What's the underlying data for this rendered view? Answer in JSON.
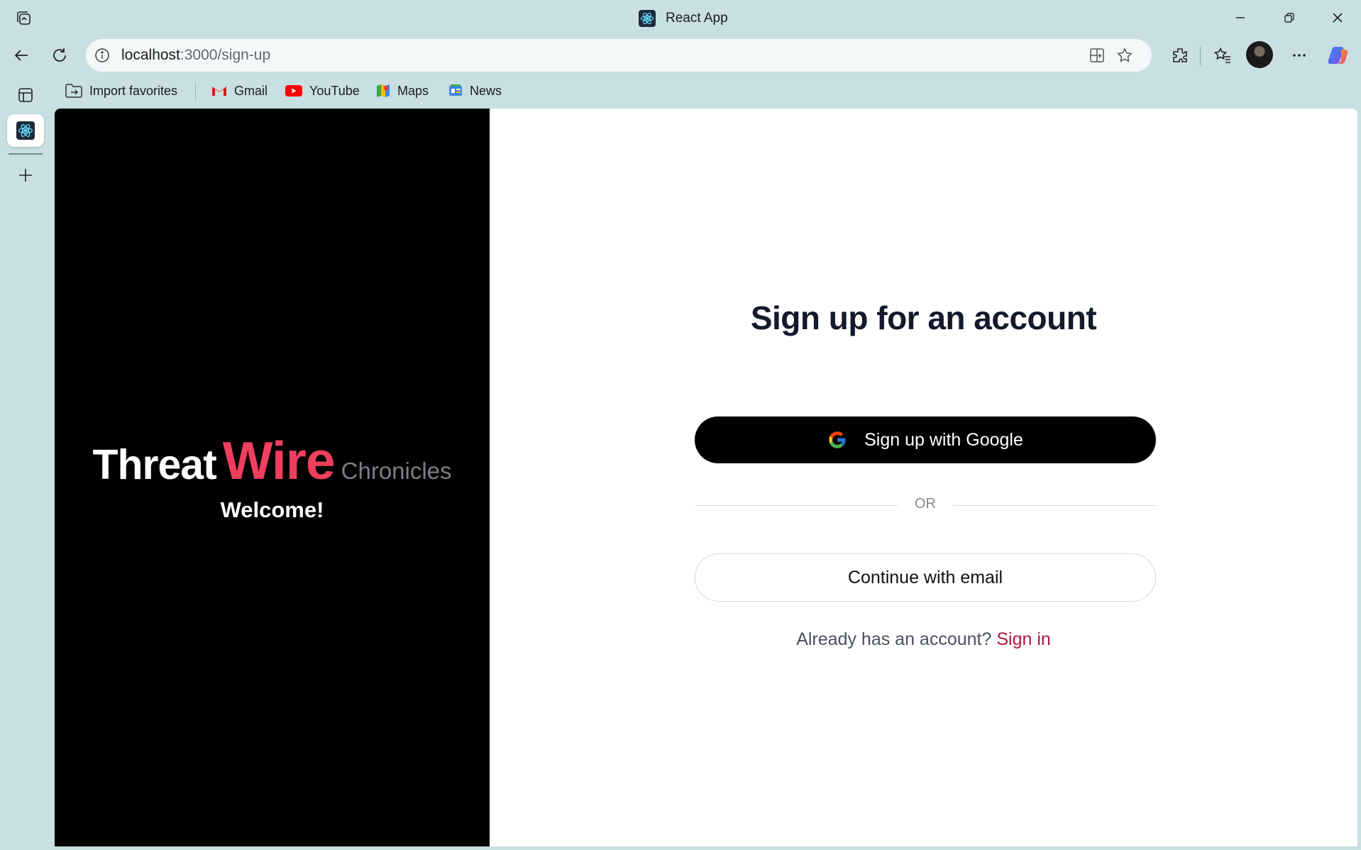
{
  "window": {
    "title": "React App",
    "favicon": "react-icon"
  },
  "address_bar": {
    "host": "localhost",
    "path": ":3000/sign-up"
  },
  "bookmarks": [
    {
      "label": "Import favorites",
      "icon": "import-folder-icon"
    },
    {
      "label": "Gmail",
      "icon": "gmail-icon"
    },
    {
      "label": "YouTube",
      "icon": "youtube-icon"
    },
    {
      "label": "Maps",
      "icon": "maps-icon"
    },
    {
      "label": "News",
      "icon": "news-icon"
    }
  ],
  "page": {
    "brand": {
      "part1": "Threat",
      "part2": "Wire",
      "part3": "Chronicles"
    },
    "welcome": "Welcome!",
    "heading": "Sign up for an account",
    "google_button": "Sign up with Google",
    "divider": "OR",
    "email_button": "Continue with email",
    "signin_prompt": "Already has an account?",
    "signin_link": "Sign in"
  },
  "colors": {
    "chrome_bg": "#c8e0e4",
    "brand_accent": "#ef3e5e",
    "link": "#b0163f",
    "left_panel": "#000000"
  }
}
